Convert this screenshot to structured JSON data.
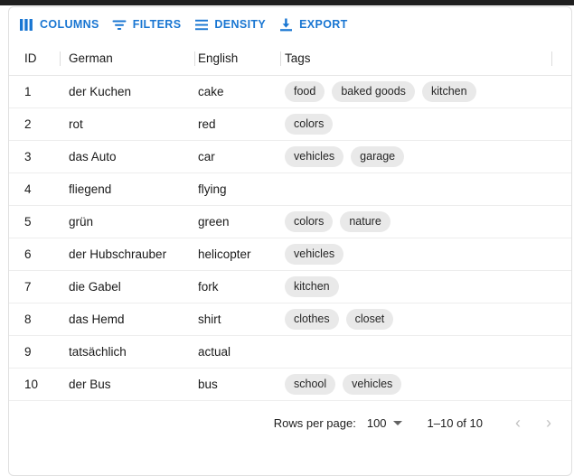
{
  "toolbar": {
    "buttons": [
      {
        "label": "COLUMNS",
        "icon": "columns-icon"
      },
      {
        "label": "FILTERS",
        "icon": "filter-funnel-icon"
      },
      {
        "label": "DENSITY",
        "icon": "density-lines-icon"
      },
      {
        "label": "EXPORT",
        "icon": "download-export-icon"
      }
    ],
    "accent_color": "#1976d2"
  },
  "table": {
    "columns": [
      {
        "field": "id",
        "header": "ID"
      },
      {
        "field": "german",
        "header": "German"
      },
      {
        "field": "english",
        "header": "English"
      },
      {
        "field": "tags",
        "header": "Tags"
      }
    ],
    "rows": [
      {
        "id": "1",
        "german": "der Kuchen",
        "english": "cake",
        "tags": [
          "food",
          "baked goods",
          "kitchen"
        ]
      },
      {
        "id": "2",
        "german": "rot",
        "english": "red",
        "tags": [
          "colors"
        ]
      },
      {
        "id": "3",
        "german": "das Auto",
        "english": "car",
        "tags": [
          "vehicles",
          "garage"
        ]
      },
      {
        "id": "4",
        "german": "fliegend",
        "english": "flying",
        "tags": []
      },
      {
        "id": "5",
        "german": "grün",
        "english": "green",
        "tags": [
          "colors",
          "nature"
        ]
      },
      {
        "id": "6",
        "german": "der Hubschrauber",
        "english": "helicopter",
        "tags": [
          "vehicles"
        ]
      },
      {
        "id": "7",
        "german": "die Gabel",
        "english": "fork",
        "tags": [
          "kitchen"
        ]
      },
      {
        "id": "8",
        "german": "das Hemd",
        "english": "shirt",
        "tags": [
          "clothes",
          "closet"
        ]
      },
      {
        "id": "9",
        "german": "tatsächlich",
        "english": "actual",
        "tags": []
      },
      {
        "id": "10",
        "german": "der Bus",
        "english": "bus",
        "tags": [
          "school",
          "vehicles"
        ]
      }
    ],
    "chip_bg_color": "#e9e9e9"
  },
  "footer": {
    "rows_per_page_label": "Rows per page:",
    "rows_per_page_value": "100",
    "range_label": "1–10 of 10",
    "prev_glyph": "‹",
    "next_glyph": "›"
  }
}
